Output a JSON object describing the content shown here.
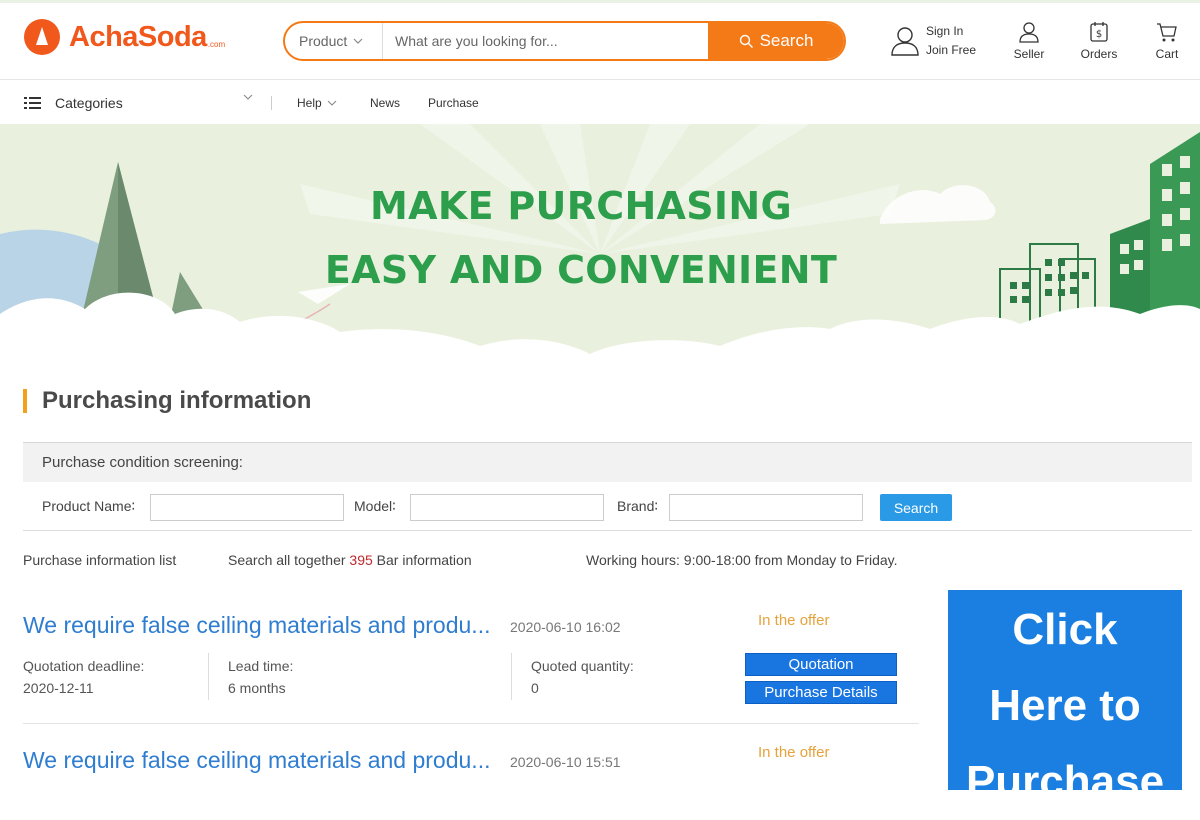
{
  "header": {
    "logo_text": "AchaSoda",
    "logo_suffix": ".com",
    "search": {
      "category": "Product",
      "placeholder": "What are you looking for...",
      "button_label": "Search"
    },
    "sign_in": "Sign In",
    "join_free": "Join Free",
    "seller": "Seller",
    "orders": "Orders",
    "cart": "Cart"
  },
  "nav": {
    "categories": "Categories",
    "help": "Help",
    "news": "News",
    "purchase": "Purchase"
  },
  "banner": {
    "line1": "MAKE PURCHASING",
    "line2": "EASY AND CONVENIENT"
  },
  "section": {
    "title": "Purchasing information",
    "filter_heading": "Purchase condition screening:",
    "filters": {
      "product_name_label": "Product Name∶",
      "model_label": "Model∶",
      "brand_label": "Brand∶",
      "product_name_value": "",
      "model_value": "",
      "brand_value": "",
      "search_button": "Search"
    },
    "info": {
      "list_label": "Purchase information list",
      "search_prefix": "Search all together",
      "count": "395",
      "search_suffix": "Bar information",
      "working_hours": "Working hours: 9:00-18:00 from Monday to Friday."
    }
  },
  "items": [
    {
      "title": "We require false ceiling materials and produ...",
      "date": "2020-06-10 16:02",
      "status": "In the offer",
      "deadline_label": "Quotation deadline:",
      "deadline": "2020-12-11",
      "lead_label": "Lead time:",
      "lead": "6 months",
      "qty_label": "Quoted quantity:",
      "qty": "0",
      "quotation_button": "Quotation",
      "details_button": "Purchase Details"
    },
    {
      "title": "We require false ceiling materials and produ...",
      "date": "2020-06-10 15:51",
      "status": "In the offer"
    }
  ],
  "ad": {
    "line1": "Click",
    "line2": "Here to",
    "line3": "Purchase"
  },
  "colors": {
    "brand_orange": "#f0581c",
    "search_orange": "#f47a18",
    "banner_green": "#2c9e4c",
    "link_blue": "#2f7dd0",
    "button_blue": "#1976e1",
    "ad_blue": "#1a7fe0",
    "status_orange": "#e6a23c",
    "count_red": "#c0282b"
  }
}
